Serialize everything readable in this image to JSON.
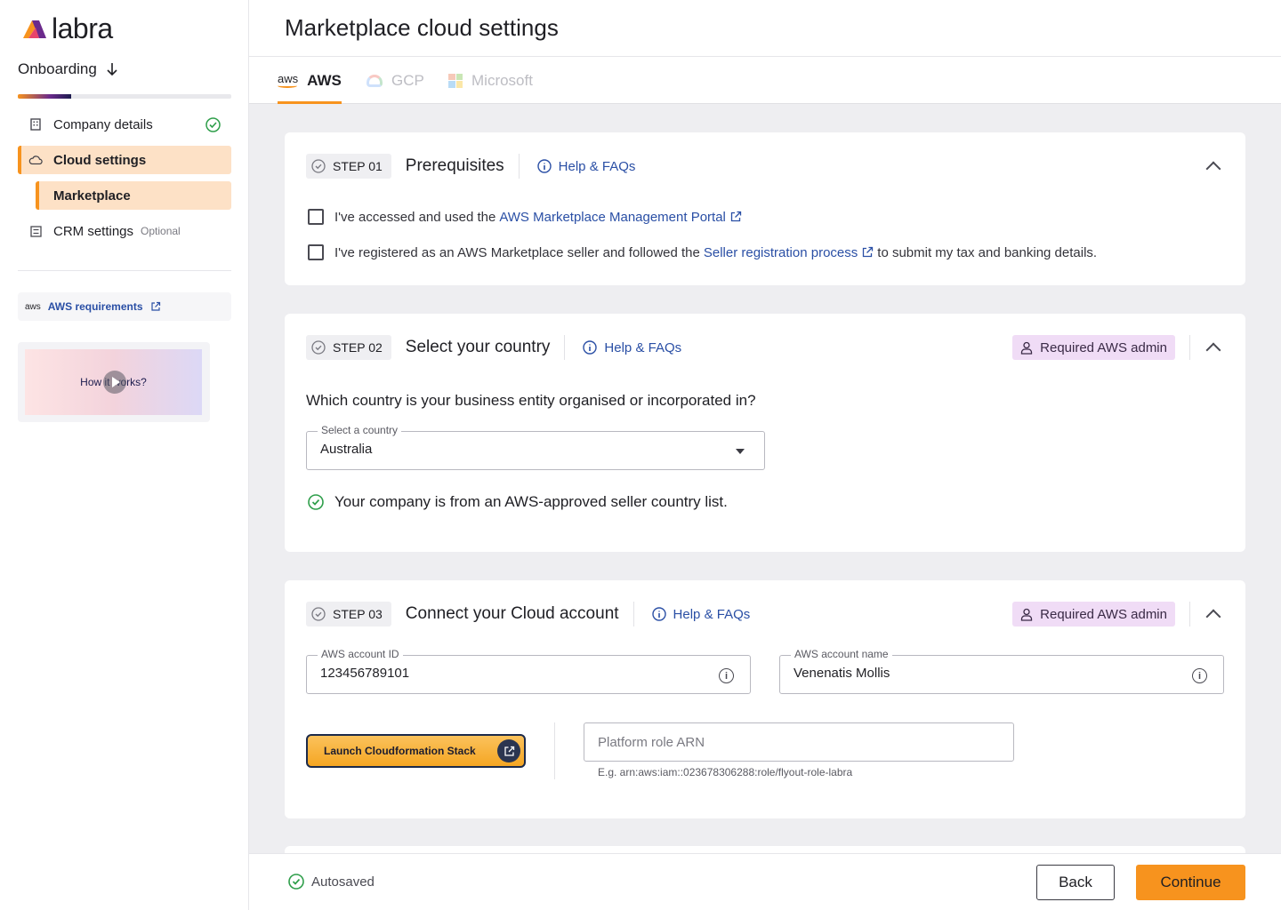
{
  "sidebar": {
    "logo_text": "labra",
    "onboarding_label": "Onboarding",
    "progress": 0.25,
    "items": [
      {
        "label": "Company details"
      },
      {
        "label": "Cloud settings"
      },
      {
        "label": "Marketplace"
      },
      {
        "label": "CRM settings",
        "tag": "Optional"
      }
    ],
    "aws_requirements": {
      "prefix": "aws",
      "label": "AWS requirements"
    },
    "video_label": "How it works?"
  },
  "header": {
    "title": "Marketplace cloud settings"
  },
  "tabs": [
    {
      "label": "AWS",
      "logo": "aws"
    },
    {
      "label": "GCP"
    },
    {
      "label": "Microsoft"
    }
  ],
  "step1": {
    "badge": "STEP 01",
    "title": "Prerequisites",
    "help": "Help & FAQs",
    "check1": {
      "before": "I've accessed and used the",
      "link": "AWS Marketplace Management Portal",
      "after": ""
    },
    "check2": {
      "before": "I've registered as an AWS Marketplace seller and followed the",
      "link": "Seller registration process",
      "after": "to submit my tax and banking details."
    }
  },
  "step2": {
    "badge": "STEP 02",
    "title": "Select your country",
    "help": "Help & FAQs",
    "admin": "Required AWS admin",
    "question": "Which country is your business entity organised or incorporated in?",
    "select_label": "Select a country",
    "select_value": "Australia",
    "success": "Your company is from an AWS-approved seller country list."
  },
  "step3": {
    "badge": "STEP 03",
    "title": "Connect your Cloud account",
    "help": "Help & FAQs",
    "admin": "Required AWS admin",
    "account_id_label": "AWS account ID",
    "account_id_value": "123456789101",
    "account_name_label": "AWS account name",
    "account_name_value": "Venenatis Mollis",
    "launch_label": "Launch Cloudformation Stack",
    "arn_placeholder": "Platform role ARN",
    "arn_hint": "E.g. arn:aws:iam::023678306288:role/flyout-role-labra"
  },
  "footer": {
    "autosaved": "Autosaved",
    "back": "Back",
    "continue": "Continue"
  },
  "colors": {
    "accent": "#f7931e",
    "link": "#2a4fa5",
    "success": "#2e9e4a",
    "admin_bg": "#f0dcf6"
  }
}
